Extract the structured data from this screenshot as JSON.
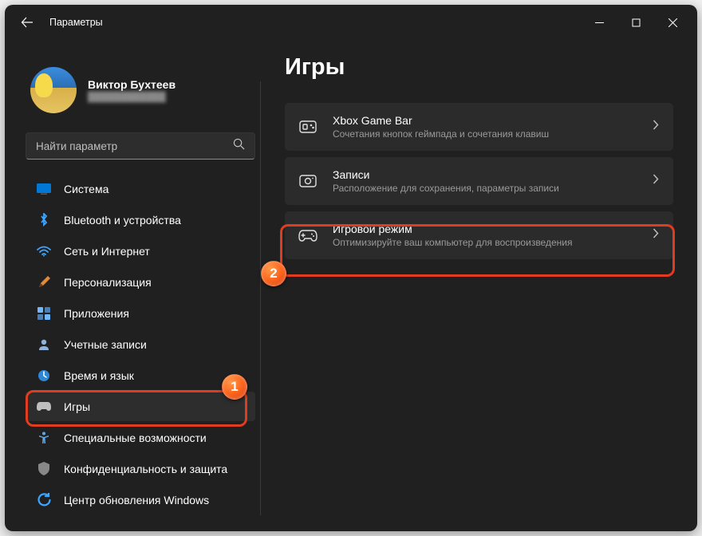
{
  "window": {
    "app_title": "Параметры"
  },
  "profile": {
    "name": "Виктор Бухтеев",
    "subtitle": "████████████"
  },
  "search": {
    "placeholder": "Найти параметр"
  },
  "sidebar": {
    "items": [
      {
        "label": "Система",
        "icon": "system"
      },
      {
        "label": "Bluetooth и устройства",
        "icon": "bluetooth"
      },
      {
        "label": "Сеть и Интернет",
        "icon": "wifi"
      },
      {
        "label": "Персонализация",
        "icon": "personalize"
      },
      {
        "label": "Приложения",
        "icon": "apps"
      },
      {
        "label": "Учетные записи",
        "icon": "account"
      },
      {
        "label": "Время и язык",
        "icon": "time"
      },
      {
        "label": "Игры",
        "icon": "gaming",
        "active": true
      },
      {
        "label": "Специальные возможности",
        "icon": "accessibility"
      },
      {
        "label": "Конфиденциальность и защита",
        "icon": "privacy"
      },
      {
        "label": "Центр обновления Windows",
        "icon": "update"
      }
    ]
  },
  "page": {
    "heading": "Игры",
    "cards": [
      {
        "title": "Xbox Game Bar",
        "subtitle": "Сочетания кнопок геймпада и сочетания клавиш",
        "icon": "xbox"
      },
      {
        "title": "Записи",
        "subtitle": "Расположение для сохранения, параметры записи",
        "icon": "capture"
      },
      {
        "title": "Игровой режим",
        "subtitle": "Оптимизируйте ваш компьютер для воспроизведения",
        "icon": "gamemode"
      }
    ]
  },
  "annotations": {
    "badge1": "1",
    "badge2": "2"
  }
}
